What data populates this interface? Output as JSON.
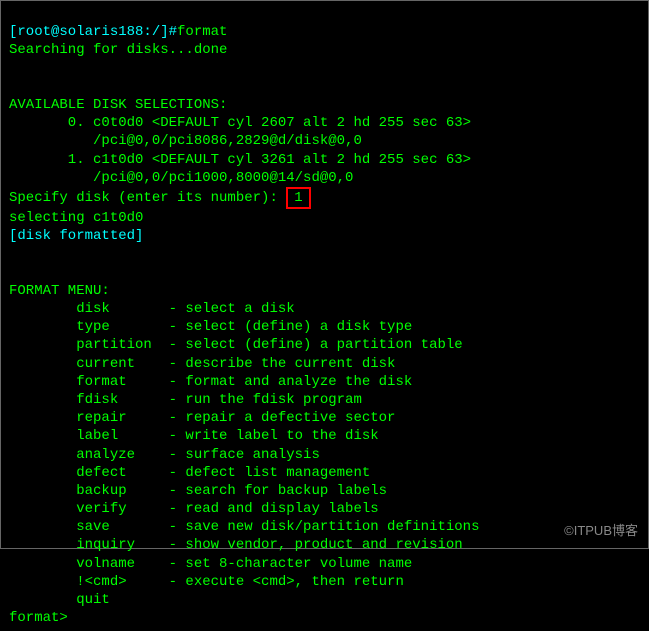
{
  "prompt": {
    "left": "[root@solaris188:/]#",
    "cmd": "format"
  },
  "searching": "Searching for disks...done",
  "avail_header": "AVAILABLE DISK SELECTIONS:",
  "disk0_line1": "       0. c0t0d0 <DEFAULT cyl 2607 alt 2 hd 255 sec 63>",
  "disk0_line2": "          /pci@0,0/pci8086,2829@d/disk@0,0",
  "disk1_line1": "       1. c1t0d0 <DEFAULT cyl 3261 alt 2 hd 255 sec 63>",
  "disk1_line2": "          /pci@0,0/pci1000,8000@14/sd@0,0",
  "specify_prompt": "Specify disk (enter its number): ",
  "specify_input": "1",
  "selecting": "selecting c1t0d0",
  "formatted": "[disk formatted]",
  "menu_header": "FORMAT MENU:",
  "menu": [
    {
      "cmd": "disk",
      "desc": "select a disk"
    },
    {
      "cmd": "type",
      "desc": "select (define) a disk type"
    },
    {
      "cmd": "partition",
      "desc": "select (define) a partition table"
    },
    {
      "cmd": "current",
      "desc": "describe the current disk"
    },
    {
      "cmd": "format",
      "desc": "format and analyze the disk"
    },
    {
      "cmd": "fdisk",
      "desc": "run the fdisk program"
    },
    {
      "cmd": "repair",
      "desc": "repair a defective sector"
    },
    {
      "cmd": "label",
      "desc": "write label to the disk"
    },
    {
      "cmd": "analyze",
      "desc": "surface analysis"
    },
    {
      "cmd": "defect",
      "desc": "defect list management"
    },
    {
      "cmd": "backup",
      "desc": "search for backup labels"
    },
    {
      "cmd": "verify",
      "desc": "read and display labels"
    },
    {
      "cmd": "save",
      "desc": "save new disk/partition definitions"
    },
    {
      "cmd": "inquiry",
      "desc": "show vendor, product and revision"
    },
    {
      "cmd": "volname",
      "desc": "set 8-character volume name"
    },
    {
      "cmd": "!<cmd>",
      "desc": "execute <cmd>, then return"
    },
    {
      "cmd": "quit",
      "desc": ""
    }
  ],
  "menu_indent": "        ",
  "menu_cmd_width": 11,
  "menu_sep": "- ",
  "format_prompt": "format> ",
  "watermark": "©ITPUB博客"
}
